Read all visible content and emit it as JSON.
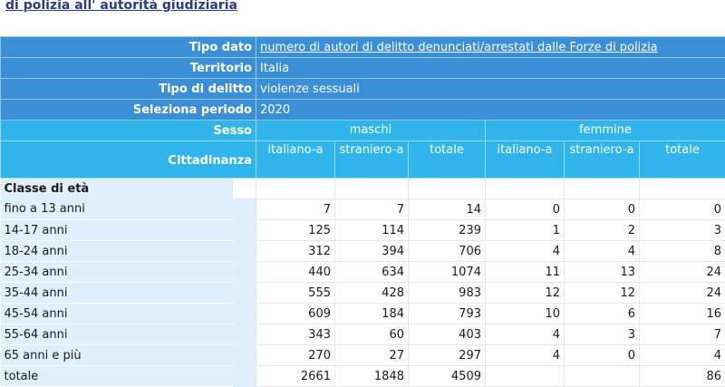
{
  "title": "di polizia all' autorità giudiziaria",
  "meta": [
    {
      "label": "Tipo dato",
      "value": "numero di autori di delitto denunciati/arrestati dalle Forze di polizia",
      "is_link": true
    },
    {
      "label": "Territorio",
      "value": "Italia",
      "is_link": false
    },
    {
      "label": "Tipo di delitto",
      "value": "violenze sessuali",
      "is_link": false
    },
    {
      "label": "Seleziona periodo",
      "value": "2020",
      "is_link": false
    }
  ],
  "header": {
    "sesso_label": "Sesso",
    "cittadinanza_label": "Cittadinanza",
    "groups": [
      "maschi",
      "femmine"
    ],
    "subcolumns": [
      "italiano-a",
      "straniero-a",
      "totale"
    ]
  },
  "row_header": "Classe di età",
  "rows": [
    {
      "label": "fino a 13 anni",
      "values": [
        7,
        7,
        14,
        0,
        0,
        0
      ]
    },
    {
      "label": "14-17 anni",
      "values": [
        125,
        114,
        239,
        1,
        2,
        3
      ]
    },
    {
      "label": "18-24 anni",
      "values": [
        312,
        394,
        706,
        4,
        4,
        8
      ]
    },
    {
      "label": "25-34 anni",
      "values": [
        440,
        634,
        1074,
        11,
        13,
        24
      ]
    },
    {
      "label": "35-44 anni",
      "values": [
        555,
        428,
        983,
        12,
        12,
        24
      ]
    },
    {
      "label": "45-54 anni",
      "values": [
        609,
        184,
        793,
        10,
        6,
        16
      ]
    },
    {
      "label": "55-64 anni",
      "values": [
        343,
        60,
        403,
        4,
        3,
        7
      ]
    },
    {
      "label": "65 anni e più",
      "values": [
        270,
        27,
        297,
        4,
        0,
        4
      ]
    },
    {
      "label": "totale",
      "values": [
        2661,
        1848,
        4509,
        "",
        "",
        86
      ]
    }
  ]
}
